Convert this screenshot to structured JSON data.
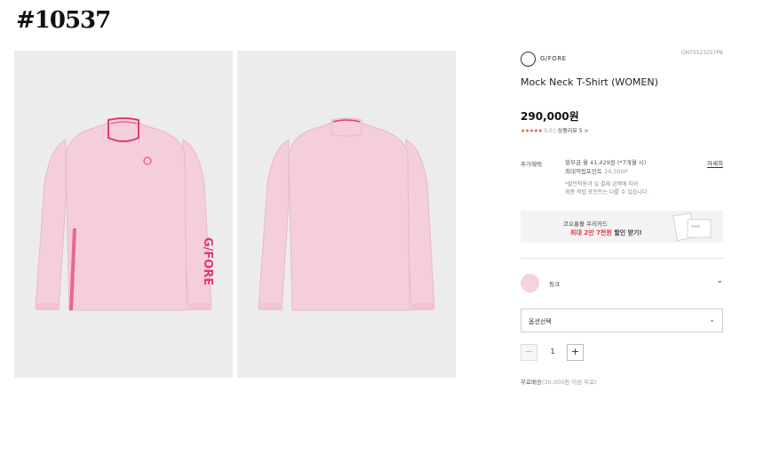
{
  "page_tag": "#10537",
  "brand": {
    "name": "G/FORE",
    "sku": "GNTSS23257PK"
  },
  "product": {
    "title": "Mock Neck T-Shirt (WOMEN)",
    "price": "290,000원",
    "rating": {
      "stars": "★★★★★",
      "score": "5.0",
      "review_label": "상품리뷰 5",
      "review_arrow": ">"
    },
    "images": [
      {
        "name": "front-view",
        "chest_logo": "GF",
        "sleeve_print": "G/FORE"
      },
      {
        "name": "back-view"
      }
    ]
  },
  "benefits": {
    "label": "추가혜택",
    "installment": "할부금 월 41,429원 (*7개월 시)",
    "points_label": "최대적립포인트",
    "points_value": "14,500P",
    "detail_link": "자세히",
    "note_line1": "*할인적용과 실 결제 금액에 따라",
    "note_line2": "최종 적립 포인트는 다를 수 있습니다."
  },
  "card_promo": {
    "line1": "코오롱몰 우리카드",
    "highlight": "최대 2만 7천원",
    "rest": " 할인 받기!"
  },
  "color_option": {
    "swatch_color": "#f5d3dc",
    "name": "핑크",
    "chevron": "⌄"
  },
  "option_select": {
    "placeholder": "옵션선택",
    "chevron": "⌄"
  },
  "quantity": {
    "minus": "−",
    "value": "1",
    "plus": "+"
  },
  "shipping": {
    "label": "무료배송",
    "condition": "(30,000원 이상 무료)"
  },
  "colors": {
    "shirt": "#f4cedb",
    "shirt_shadow": "#e9b9c8",
    "accent": "#e23a6d",
    "image_bg": "#ececec"
  }
}
